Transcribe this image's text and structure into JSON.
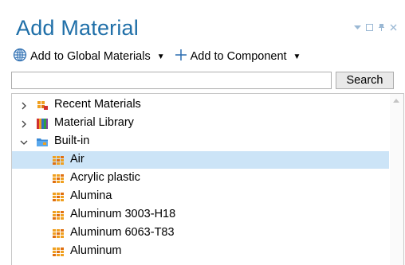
{
  "window": {
    "title": "Add Material"
  },
  "toolbar": {
    "global_label": "Add to Global Materials",
    "component_label": "Add to Component"
  },
  "search": {
    "value": "",
    "button_label": "Search"
  },
  "tree": {
    "categories": [
      {
        "label": "Recent Materials",
        "expanded": false,
        "icon": "recent-materials-icon"
      },
      {
        "label": "Material Library",
        "expanded": false,
        "icon": "material-library-icon"
      },
      {
        "label": "Built-in",
        "expanded": true,
        "icon": "folder-icon"
      }
    ],
    "items": [
      {
        "label": "Air",
        "selected": true,
        "icon": "material-icon"
      },
      {
        "label": "Acrylic plastic",
        "selected": false,
        "icon": "material-icon"
      },
      {
        "label": "Alumina",
        "selected": false,
        "icon": "material-icon"
      },
      {
        "label": "Aluminum 3003-H18",
        "selected": false,
        "icon": "material-icon"
      },
      {
        "label": "Aluminum 6063-T83",
        "selected": false,
        "icon": "material-icon"
      },
      {
        "label": "Aluminum",
        "selected": false,
        "icon": "material-icon"
      }
    ]
  },
  "colors": {
    "title": "#1f6fa8",
    "selection": "#cce4f7",
    "material_icon": "#f0a020"
  }
}
